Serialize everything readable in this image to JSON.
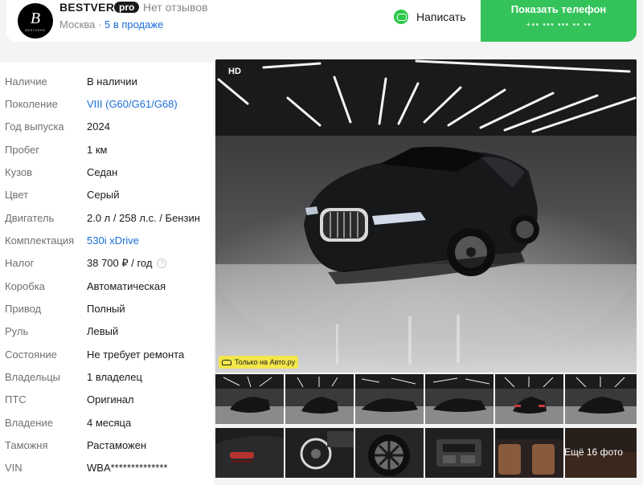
{
  "header": {
    "logo_mark": "B",
    "logo_text": "BESTVERS",
    "dealer_name": "BESTVERS",
    "pro_label": "pro",
    "reviews": "Нет отзывов",
    "city": "Москва",
    "separator": "·",
    "on_sale": "5 в продаже",
    "write_label": "Написать",
    "phone_label": "Показать телефон",
    "phone_masked": "+•• ••• ••• •• ••",
    "accent_green": "#33c35a",
    "link_blue": "#1a6dd6"
  },
  "specs": [
    {
      "key": "Наличие",
      "value": "В наличии"
    },
    {
      "key": "Поколение",
      "value": "VIII (G60/G61/G68)",
      "link": true
    },
    {
      "key": "Год выпуска",
      "value": "2024"
    },
    {
      "key": "Пробег",
      "value": "1 км"
    },
    {
      "key": "Кузов",
      "value": "Седан"
    },
    {
      "key": "Цвет",
      "value": "Серый"
    },
    {
      "key": "Двигатель",
      "value": "2.0 л / 258 л.с. / Бензин"
    },
    {
      "key": "Комплектация",
      "value": "530i xDrive",
      "link": true
    },
    {
      "key": "Налог",
      "value": "38 700 ₽ / год",
      "help": true
    },
    {
      "key": "Коробка",
      "value": "Автоматическая"
    },
    {
      "key": "Привод",
      "value": "Полный"
    },
    {
      "key": "Руль",
      "value": "Левый"
    },
    {
      "key": "Состояние",
      "value": "Не требует ремонта"
    },
    {
      "key": "Владельцы",
      "value": "1 владелец"
    },
    {
      "key": "ПТС",
      "value": "Оригинал"
    },
    {
      "key": "Владение",
      "value": "4 месяца"
    },
    {
      "key": "Таможня",
      "value": "Растаможен"
    },
    {
      "key": "VIN",
      "value": "WBA**************"
    }
  ],
  "gallery": {
    "hd_label": "HD",
    "only_label": "Только на Авто.ру",
    "more_photos": "Ещё 16 фото"
  }
}
